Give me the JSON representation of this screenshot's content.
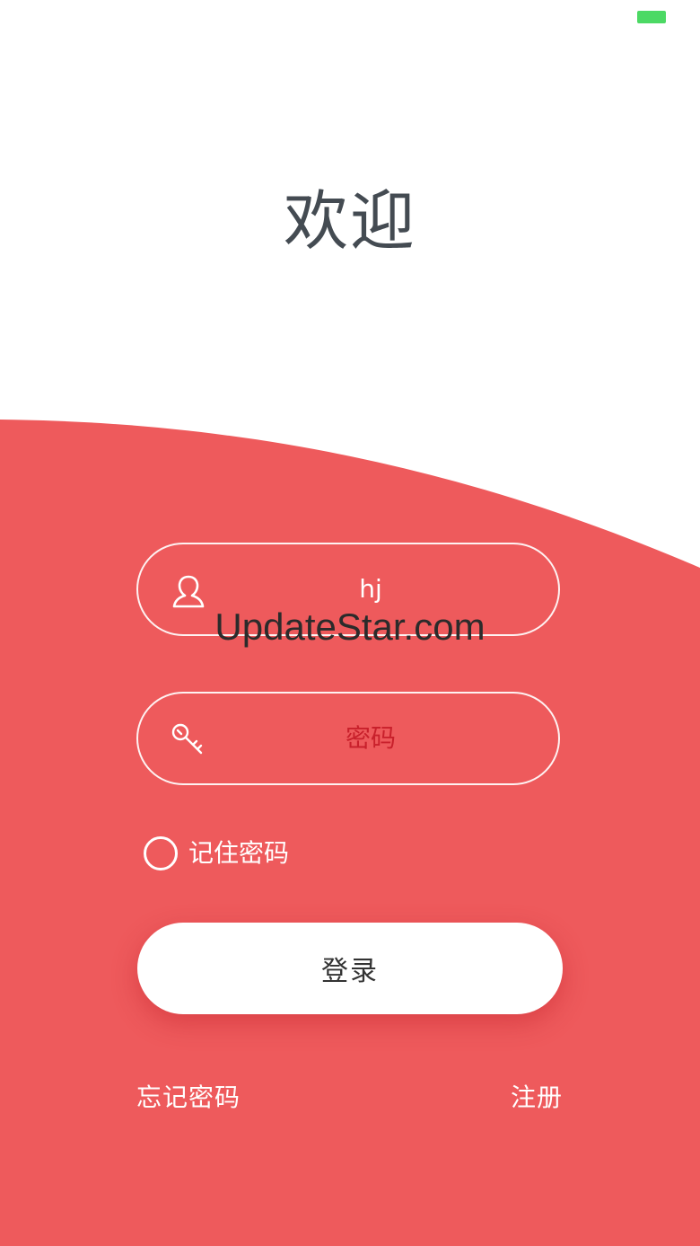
{
  "colors": {
    "accent": "#ee5a5c",
    "status_indicator": "#4cd964",
    "title": "#444b52",
    "placeholder": "#c8202b"
  },
  "header": {
    "title": "欢迎"
  },
  "form": {
    "username": {
      "icon": "user-icon",
      "value": "hj"
    },
    "password": {
      "icon": "key-icon",
      "placeholder": "密码"
    },
    "remember": {
      "label": "记住密码",
      "checked": false
    },
    "login_label": "登录"
  },
  "links": {
    "forgot": "忘记密码",
    "register": "注册"
  },
  "watermark": "UpdateStar.com"
}
